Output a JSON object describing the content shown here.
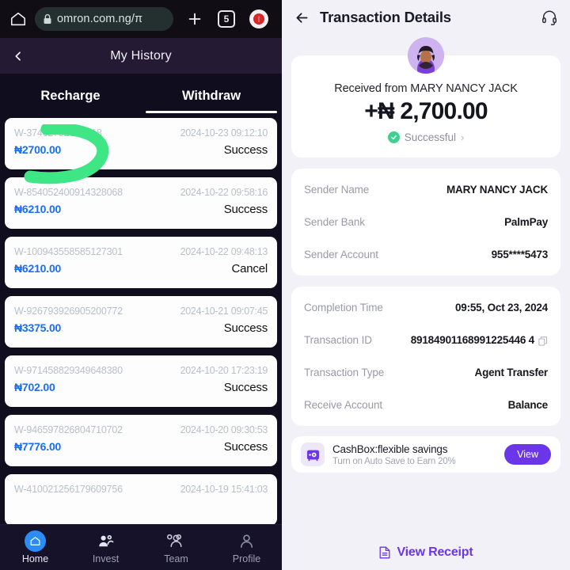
{
  "browser": {
    "home_icon": "home-icon",
    "lock_icon": "lock-icon",
    "url": "omron.com.ng/π",
    "new_tab_icon": "plus-icon",
    "tab_count": "5",
    "menu_icon": "menu-dot-icon"
  },
  "history": {
    "header_title": "My History",
    "back_icon": "chevron-left-icon",
    "tabs": [
      {
        "label": "Recharge",
        "active": false
      },
      {
        "label": "Withdraw",
        "active": true
      }
    ],
    "transactions": [
      {
        "id": "W-3746279265 7518",
        "date": "2024-10-23 09:12:10",
        "amount": "₦2700.00",
        "status": "Success"
      },
      {
        "id": "W-854052400914328068",
        "date": "2024-10-22 09:58:16",
        "amount": "₦6210.00",
        "status": "Success"
      },
      {
        "id": "W-100943558585127301",
        "date": "2024-10-22 09:48:13",
        "amount": "₦6210.00",
        "status": "Cancel"
      },
      {
        "id": "W-926793926905200772",
        "date": "2024-10-21 09:07:45",
        "amount": "₦3375.00",
        "status": "Success"
      },
      {
        "id": "W-971458829349648380",
        "date": "2024-10-20 17:23:19",
        "amount": "₦702.00",
        "status": "Success"
      },
      {
        "id": "W-946597826804710702",
        "date": "2024-10-20 09:30:53",
        "amount": "₦7776.00",
        "status": "Success"
      },
      {
        "id": "W-410021256179609756",
        "date": "2024-10-19 15:41:03",
        "amount": "",
        "status": ""
      }
    ],
    "annotation": {
      "name": "green-highlight-stroke",
      "color": "#3ee686"
    }
  },
  "bottom_nav": [
    {
      "label": "Home",
      "icon": "home-icon",
      "active": true
    },
    {
      "label": "Invest",
      "icon": "invest-people-icon",
      "active": false
    },
    {
      "label": "Team",
      "icon": "team-group-icon",
      "active": false
    },
    {
      "label": "Profile",
      "icon": "profile-person-icon",
      "active": false
    }
  ],
  "detail": {
    "back_icon": "arrow-left-icon",
    "title": "Transaction Details",
    "support_icon": "headset-icon",
    "avatar": "user-avatar",
    "received_from": "Received from MARY NANCY JACK",
    "amount": "+₦ 2,700.00",
    "status": "Successful",
    "status_chevron": "chevron-right-icon",
    "sender_rows": [
      {
        "label": "Sender Name",
        "value": "MARY NANCY JACK"
      },
      {
        "label": "Sender Bank",
        "value": "PalmPay"
      },
      {
        "label": "Sender Account",
        "value": "955****5473"
      }
    ],
    "meta_rows": [
      {
        "label": "Completion Time",
        "value": "09:55, Oct 23, 2024",
        "copy": false
      },
      {
        "label": "Transaction ID",
        "value": "89184901168991225446 4",
        "copy": true
      },
      {
        "label": "Transaction Type",
        "value": "Agent Transfer",
        "copy": false
      },
      {
        "label": "Receive Account",
        "value": "Balance",
        "copy": false
      }
    ],
    "promo": {
      "icon": "safe-box-icon",
      "title": "CashBox:flexible savings",
      "subtitle": "Turn on Auto Save to Earn 20%",
      "button_label": "View"
    },
    "receipt": {
      "icon": "document-icon",
      "label": "View Receipt"
    }
  },
  "colors": {
    "accent_purple": "#6b35e8",
    "amount_blue": "#1a6ef5",
    "success_green": "#3fcf8e",
    "annotation_green": "#3ee686",
    "nav_active_blue": "#2b8cf5"
  }
}
